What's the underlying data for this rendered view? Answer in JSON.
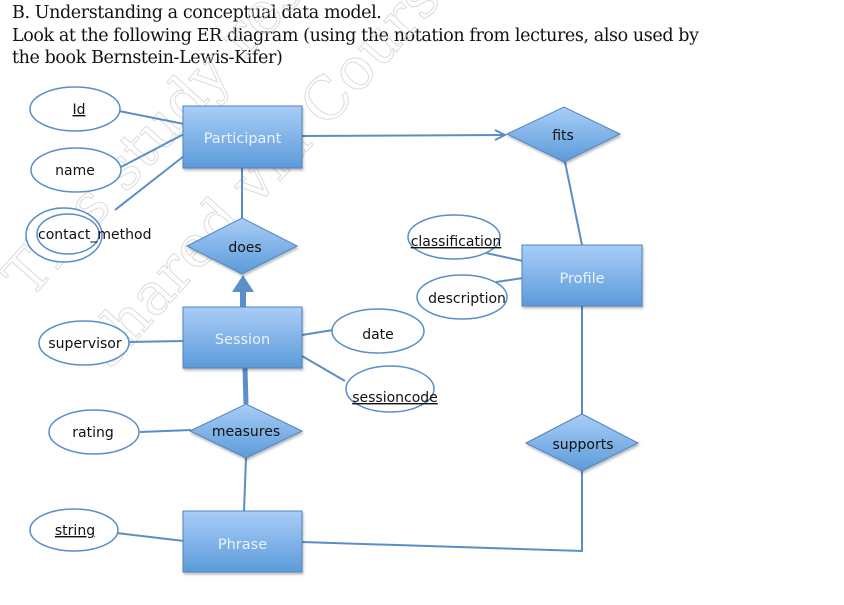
{
  "document": {
    "heading": "B. Understanding a conceptual data model.",
    "intro_line1": "Look at the following ER diagram (using the notation from lectures, also used by",
    "intro_line2": "the book Bernstein-Lewis-Kifer)"
  },
  "watermark": {
    "line1": "This study resource was",
    "line2": "shared via CourseHero"
  },
  "diagram": {
    "colors": {
      "shape_fill_top": "#a9cdf7",
      "shape_fill_bottom": "#5b9bd9",
      "stroke": "#5a8ec8",
      "ellipse_stroke": "#5a8ec8"
    },
    "entities": {
      "participant": "Participant",
      "session": "Session",
      "phrase": "Phrase",
      "profile": "Profile"
    },
    "relationships": {
      "does": "does",
      "fits": "fits",
      "measures": "measures",
      "supports": "supports"
    },
    "attributes": {
      "id": {
        "label": "Id",
        "key": true,
        "multivalued": false
      },
      "name": {
        "label": "name",
        "key": false,
        "multivalued": false
      },
      "contact_method": {
        "label": "contact_method",
        "key": false,
        "multivalued": true
      },
      "supervisor": {
        "label": "supervisor",
        "key": false,
        "multivalued": false
      },
      "rating": {
        "label": "rating",
        "key": false,
        "multivalued": false
      },
      "string": {
        "label": "string",
        "key": true,
        "multivalued": false
      },
      "classification": {
        "label": "classification",
        "key": true,
        "multivalued": false
      },
      "description": {
        "label": "description",
        "key": false,
        "multivalued": false
      },
      "date": {
        "label": "date",
        "key": false,
        "multivalued": false
      },
      "sessioncode": {
        "label": "sessioncode",
        "key": true,
        "multivalued": false
      }
    },
    "connections": [
      {
        "from": "Id",
        "to": "Participant",
        "type": "attribute"
      },
      {
        "from": "name",
        "to": "Participant",
        "type": "attribute"
      },
      {
        "from": "contact_method",
        "to": "Participant",
        "type": "attribute"
      },
      {
        "from": "Participant",
        "to": "fits",
        "type": "arrow"
      },
      {
        "from": "fits",
        "to": "Profile",
        "type": "line"
      },
      {
        "from": "Participant",
        "to": "does",
        "type": "line"
      },
      {
        "from": "Session",
        "to": "does",
        "type": "bold-arrow"
      },
      {
        "from": "supervisor",
        "to": "Session",
        "type": "attribute"
      },
      {
        "from": "date",
        "to": "Session",
        "type": "attribute"
      },
      {
        "from": "sessioncode",
        "to": "Session",
        "type": "attribute"
      },
      {
        "from": "Session",
        "to": "measures",
        "type": "bold-line"
      },
      {
        "from": "rating",
        "to": "measures",
        "type": "attribute"
      },
      {
        "from": "measures",
        "to": "Phrase",
        "type": "line"
      },
      {
        "from": "string",
        "to": "Phrase",
        "type": "attribute"
      },
      {
        "from": "classification",
        "to": "Profile",
        "type": "attribute"
      },
      {
        "from": "description",
        "to": "Profile",
        "type": "attribute"
      },
      {
        "from": "Profile",
        "to": "supports",
        "type": "line"
      },
      {
        "from": "supports",
        "to": "Phrase",
        "type": "line"
      }
    ]
  }
}
